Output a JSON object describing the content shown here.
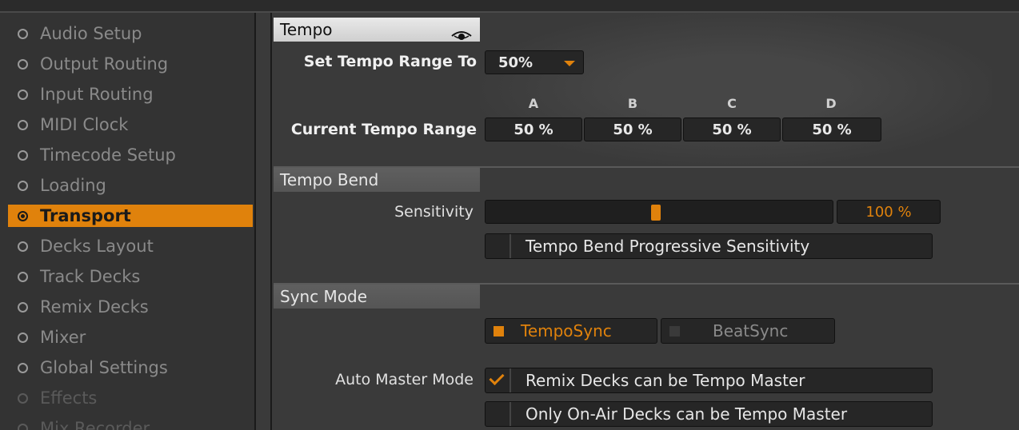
{
  "sidebar": {
    "items": [
      {
        "label": "Audio Setup"
      },
      {
        "label": "Output Routing"
      },
      {
        "label": "Input Routing"
      },
      {
        "label": "MIDI Clock"
      },
      {
        "label": "Timecode Setup"
      },
      {
        "label": "Loading"
      },
      {
        "label": "Transport"
      },
      {
        "label": "Decks Layout"
      },
      {
        "label": "Track Decks"
      },
      {
        "label": "Remix Decks"
      },
      {
        "label": "Mixer"
      },
      {
        "label": "Global Settings"
      },
      {
        "label": "Effects"
      },
      {
        "label": "Mix Recorder"
      }
    ],
    "active_index": 6
  },
  "tempo": {
    "header": "Tempo",
    "set_range_label": "Set Tempo Range To",
    "set_range_value": "50%",
    "current_range_label": "Current Tempo Range",
    "columns": [
      {
        "letter": "A",
        "value": "50 %"
      },
      {
        "letter": "B",
        "value": "50 %"
      },
      {
        "letter": "C",
        "value": "50 %"
      },
      {
        "letter": "D",
        "value": "50 %"
      }
    ]
  },
  "tempo_bend": {
    "header": "Tempo Bend",
    "sensitivity_label": "Sensitivity",
    "sensitivity_value": "100 %",
    "sensitivity_fraction": 0.49,
    "progressive_label": "Tempo Bend Progressive Sensitivity",
    "progressive_checked": false
  },
  "sync_mode": {
    "header": "Sync Mode",
    "tempo_sync_label": "TempoSync",
    "beat_sync_label": "BeatSync",
    "selected": "TempoSync",
    "auto_master_label": "Auto Master Mode",
    "remix_master_label": "Remix Decks can be Tempo Master",
    "remix_master_checked": true,
    "onair_master_label": "Only On-Air Decks can be Tempo Master",
    "onair_master_checked": false
  },
  "colors": {
    "accent": "#e0820c",
    "panel": "#3a3a3a",
    "field": "#262626"
  },
  "icons": {
    "tempo_header_icon": "eye-icon"
  }
}
